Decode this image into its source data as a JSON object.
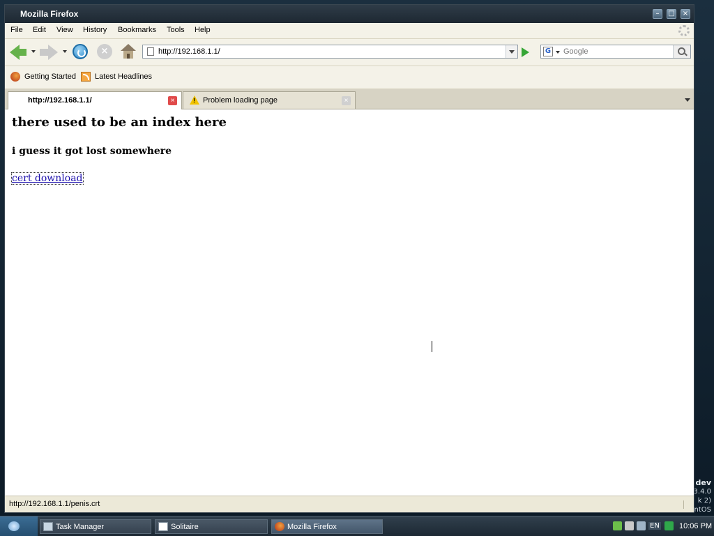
{
  "window": {
    "title": "Mozilla Firefox"
  },
  "menubar": {
    "items": [
      "File",
      "Edit",
      "View",
      "History",
      "Bookmarks",
      "Tools",
      "Help"
    ]
  },
  "navbar": {
    "url": "http://192.168.1.1/",
    "search_placeholder": "Google"
  },
  "bookmarks": {
    "items": [
      "Getting Started",
      "Latest Headlines"
    ]
  },
  "tabs": [
    {
      "label": "http://192.168.1.1/",
      "active": true
    },
    {
      "label": "Problem loading page",
      "active": false
    }
  ],
  "page": {
    "heading": "there used to be an index here",
    "subheading": "i guess it got lost somewhere",
    "link": "cert download"
  },
  "status": {
    "text": "http://192.168.1.1/penis.crt"
  },
  "desktop": {
    "lines": [
      "dev",
      "3.4.0",
      "k 2)",
      "ntOS"
    ]
  },
  "taskbar": {
    "tasks": [
      "Task Manager",
      "Solitaire",
      "Mozilla Firefox"
    ],
    "tray_lang": "EN",
    "clock": "10:06 PM"
  }
}
